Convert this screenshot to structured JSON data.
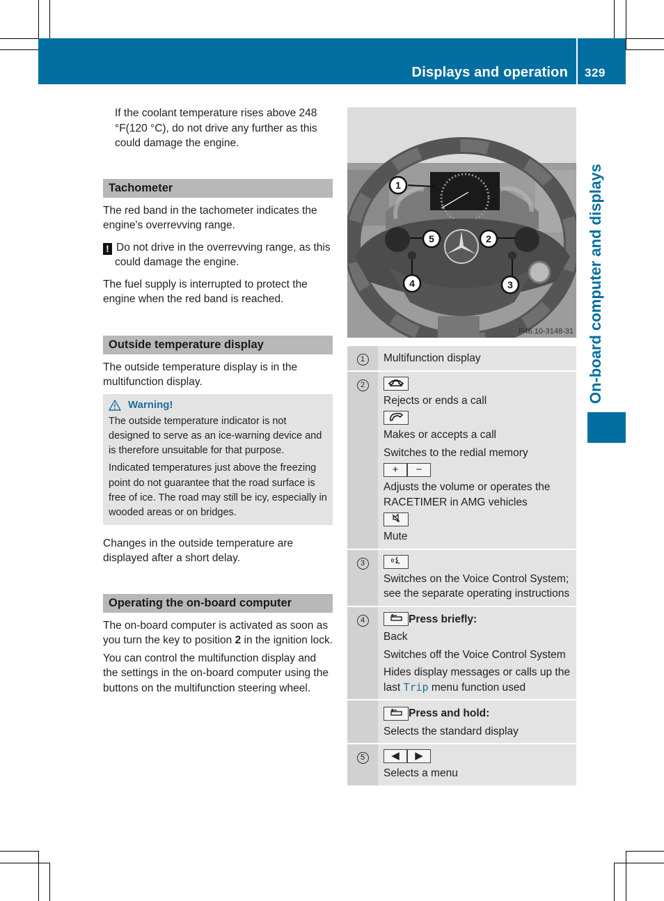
{
  "header": {
    "title": "Displays and operation",
    "page_number": "329",
    "side_tab": "On-board computer and displays"
  },
  "left": {
    "intro_text": "If the coolant temperature rises above 248 °F(120 °C), do not drive any further as this could damage the engine.",
    "sections": [
      {
        "heading": "Tachometer",
        "p1": "The red band in the tachometer indicates the engine's overrevving range.",
        "caution": "Do not drive in the overrevving range, as this could damage the engine.",
        "p2": "The fuel supply is interrupted to protect the engine when the red band is reached."
      },
      {
        "heading": "Outside temperature display",
        "p1": "The outside temperature display is in the multifunction display.",
        "warning_title": "Warning!",
        "warning_p1": "The outside temperature indicator is not designed to serve as an ice-warning device and is therefore unsuitable for that purpose.",
        "warning_p2": "Indicated temperatures just above the freezing point do not guarantee that the road surface is free of ice. The road may still be icy, especially in wooded areas or on bridges.",
        "p2": "Changes in the outside temperature are displayed after a short delay."
      },
      {
        "heading": "Operating the on-board computer",
        "p1_before": "The on-board computer is activated as soon as you turn the key to position ",
        "p1_bold": "2",
        "p1_after": " in the ignition lock.",
        "p2": "You can control the multifunction display and the settings in the on-board computer using the buttons on the multifunction steering wheel."
      }
    ]
  },
  "figure": {
    "caption": "P46.10-3148-31",
    "callouts": [
      "1",
      "2",
      "3",
      "4",
      "5"
    ]
  },
  "legend": {
    "rows": [
      {
        "num": "1",
        "text": "Multifunction display"
      },
      {
        "num": "2",
        "end_call": "Rejects or ends a call",
        "make_call": "Makes or accepts a call",
        "redial": "Switches to the redial memory",
        "plus": "+",
        "minus": "−",
        "volume": "Adjusts the volume or operates the RACETIMER in AMG vehicles",
        "mute": "Mute"
      },
      {
        "num": "3",
        "text": "Switches on the Voice Control System; see the separate operating instructions"
      },
      {
        "num": "4",
        "press_label": "Press briefly:",
        "back": "Back",
        "voice_off": "Switches off the Voice Control System",
        "hide_before": "Hides display messages or calls up the last ",
        "trip": "Trip",
        "hide_after": " menu function used"
      },
      {
        "num": "",
        "hold_label": "Press and hold:",
        "standard": "Selects the standard display"
      },
      {
        "num": "5",
        "left": "◀",
        "right": "▶",
        "text": "Selects a menu"
      }
    ]
  },
  "colors": {
    "brand_blue": "#006ea0",
    "section_gray": "#b8b8b8",
    "box_gray": "#e3e3e3"
  }
}
